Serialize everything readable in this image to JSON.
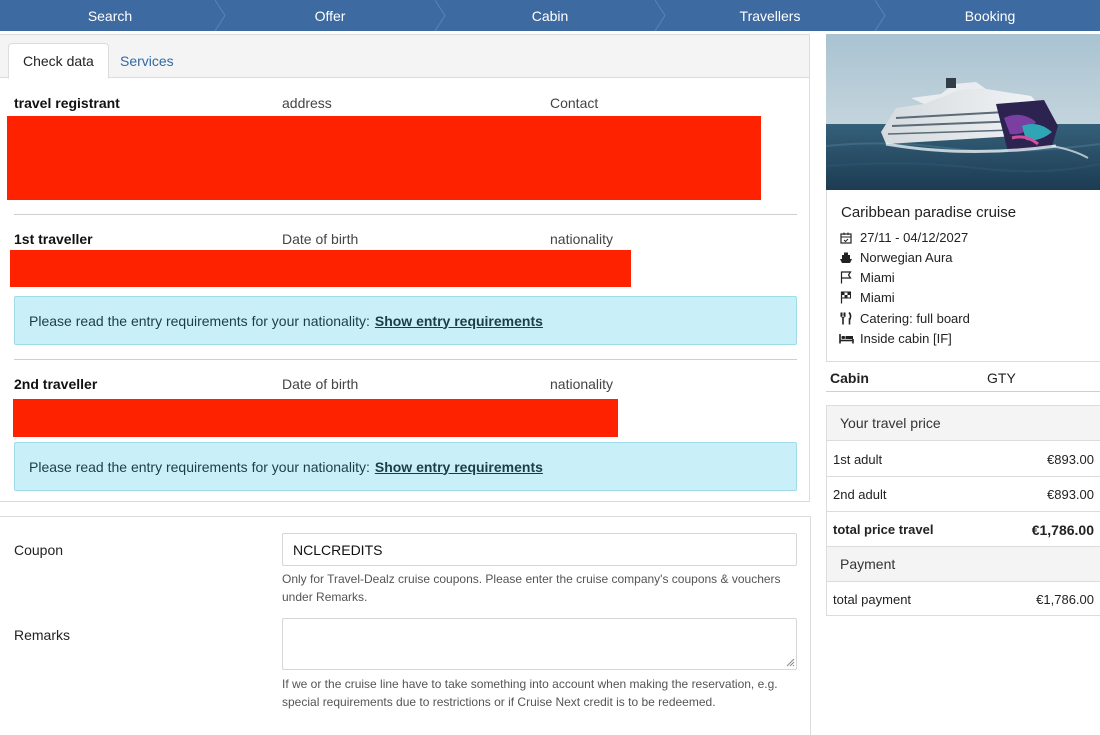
{
  "steps": [
    "Search",
    "Offer",
    "Cabin",
    "Travellers",
    "Booking"
  ],
  "tabs": {
    "check_data": "Check data",
    "services": "Services"
  },
  "registrant": {
    "title": "travel registrant",
    "col2": "address",
    "col3": "Contact"
  },
  "traveller1": {
    "title": "1st traveller",
    "col2": "Date of birth",
    "col3": "nationality"
  },
  "traveller2": {
    "title": "2nd traveller",
    "col2": "Date of birth",
    "col3": "nationality"
  },
  "alert": {
    "text": "Please read the entry requirements for your nationality:",
    "link": "Show entry requirements"
  },
  "form": {
    "coupon_label": "Coupon",
    "coupon_value": "NCLCREDITS",
    "coupon_help_1": "Only for Travel-Dealz cruise coupons. Please enter the cruise company's coupons & vouchers",
    "coupon_help_2": "under Remarks.",
    "remarks_label": "Remarks",
    "remarks_help_1": "If we or the cruise line have to take something into account when making the reservation, e.g.",
    "remarks_help_2": "special requirements due to restrictions or if Cruise Next credit is to be redeemed."
  },
  "cruise": {
    "title": "Caribbean paradise cruise",
    "dates": "27/11 - 04/12/2027",
    "ship": "Norwegian Aura",
    "departure": "Miami",
    "arrival": "Miami",
    "catering": "Catering: full board",
    "cabin_type": "Inside cabin [IF]"
  },
  "cabin": {
    "label": "Cabin",
    "value": "GTY"
  },
  "price": {
    "header": "Your travel price",
    "rows": [
      {
        "label": "1st adult",
        "value": "€893.00"
      },
      {
        "label": "2nd adult",
        "value": "€893.00"
      }
    ],
    "total_label": "total price travel",
    "total_value": "€1,786.00",
    "payment_header": "Payment",
    "payment_label": "total payment",
    "payment_value": "€1,786.00"
  },
  "colors": {
    "nav": "#3d6aa0",
    "redaction": "#ff2200",
    "alert_bg": "#c9f0f8",
    "link": "#2f6aa5"
  },
  "icons": [
    "calendar-icon",
    "ship-icon",
    "flag-icon",
    "checkered-flag-icon",
    "cutlery-icon",
    "bed-icon"
  ]
}
